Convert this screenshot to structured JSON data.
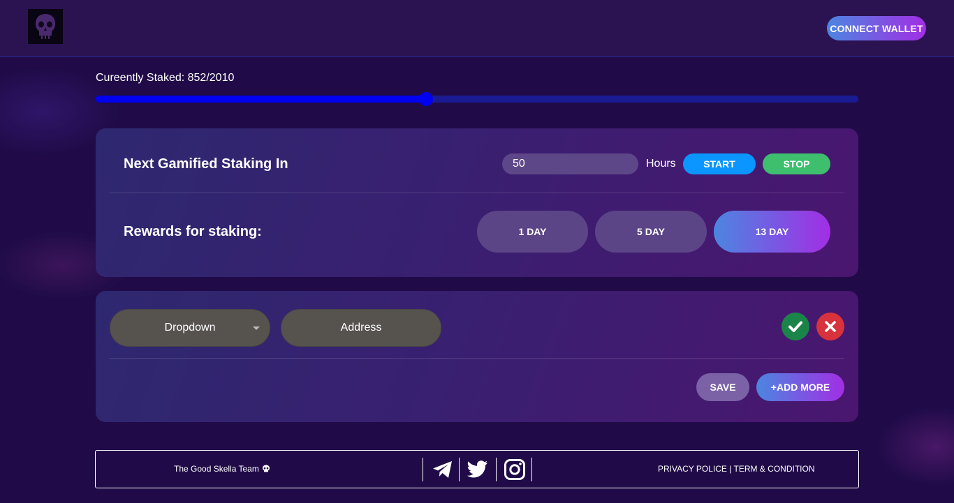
{
  "header": {
    "connect_label": "CONNECT WALLET"
  },
  "staking": {
    "label": "Cureently Staked: 852/2010",
    "staked": 852,
    "total": 2010
  },
  "gamified": {
    "title": "Next Gamified Staking In",
    "hours_value": "50",
    "hours_unit": "Hours",
    "start_label": "START",
    "stop_label": "STOP"
  },
  "rewards": {
    "title": "Rewards for staking:",
    "options": [
      "1 DAY",
      "5 DAY",
      "13 DAY"
    ],
    "selected": "13 DAY"
  },
  "entry": {
    "dropdown_label": "Dropdown",
    "address_placeholder": "Address",
    "save_label": "SAVE",
    "add_more_label": "+ADD MORE"
  },
  "footer": {
    "team": "The Good Skella Team",
    "links": "PRIVACY POLICE | TERM & CONDITION"
  },
  "colors": {
    "accent_start": "#4c86e0",
    "accent_end": "#a22ee4",
    "start": "#0b96ff",
    "stop": "#3dbf6e",
    "confirm": "#1b8448",
    "cancel": "#d8323c",
    "slider": "#0000f0"
  },
  "icons": {
    "logo": "skull-icon",
    "confirm": "check-icon",
    "cancel": "close-icon",
    "dropdown": "caret-down-icon",
    "team": "skull-emoji-icon",
    "social": [
      "telegram-icon",
      "twitter-icon",
      "instagram-icon"
    ]
  }
}
